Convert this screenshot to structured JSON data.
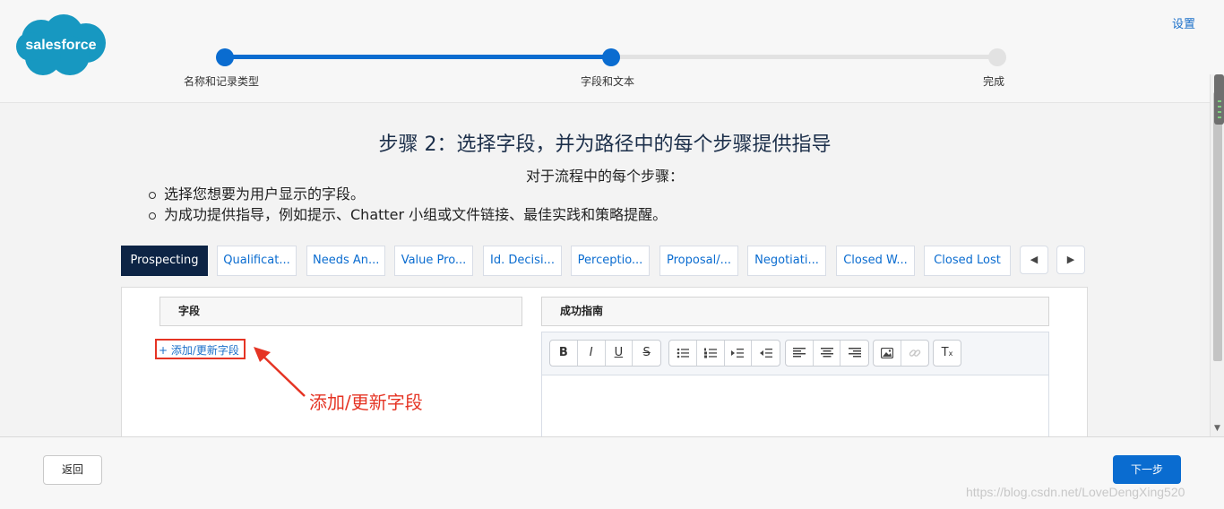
{
  "header": {
    "logo_text": "salesforce",
    "settings_label": "设置",
    "steps": [
      {
        "label": "名称和记录类型",
        "state": "done"
      },
      {
        "label": "字段和文本",
        "state": "current"
      },
      {
        "label": "完成",
        "state": "todo"
      }
    ]
  },
  "content": {
    "title": "步骤 2：选择字段，并为路径中的每个步骤提供指导",
    "subtitle": "对于流程中的每个步骤：",
    "bullets": [
      "选择您想要为用户显示的字段。",
      "为成功提供指导，例如提示、Chatter 小组或文件链接、最佳实践和策略提醒。"
    ]
  },
  "stages": [
    {
      "label": "Prospecting",
      "active": true
    },
    {
      "label": "Qualificat...",
      "active": false
    },
    {
      "label": "Needs An...",
      "active": false
    },
    {
      "label": "Value Pro...",
      "active": false
    },
    {
      "label": "Id. Decisi...",
      "active": false
    },
    {
      "label": "Perceptio...",
      "active": false
    },
    {
      "label": "Proposal/...",
      "active": false
    },
    {
      "label": "Negotiati...",
      "active": false
    },
    {
      "label": "Closed W...",
      "active": false
    },
    {
      "label": "Closed Lost",
      "active": false
    }
  ],
  "nav": {
    "prev_icon": "◀",
    "next_icon": "▶"
  },
  "panel": {
    "fields_header": "字段",
    "guidance_header": "成功指南",
    "add_link": "+ 添加/更新字段",
    "annotation": "添加/更新字段",
    "toolbar": {
      "bold": "B",
      "italic": "I",
      "underline": "U",
      "strike": "S",
      "clear": "T"
    }
  },
  "footer": {
    "back_label": "返回",
    "next_label": "下一步",
    "watermark": "https://blog.csdn.net/LoveDengXing520"
  },
  "colors": {
    "brand_blue": "#0a6cd0",
    "active_stage": "#0d2445",
    "annotation_red": "#e53424"
  }
}
